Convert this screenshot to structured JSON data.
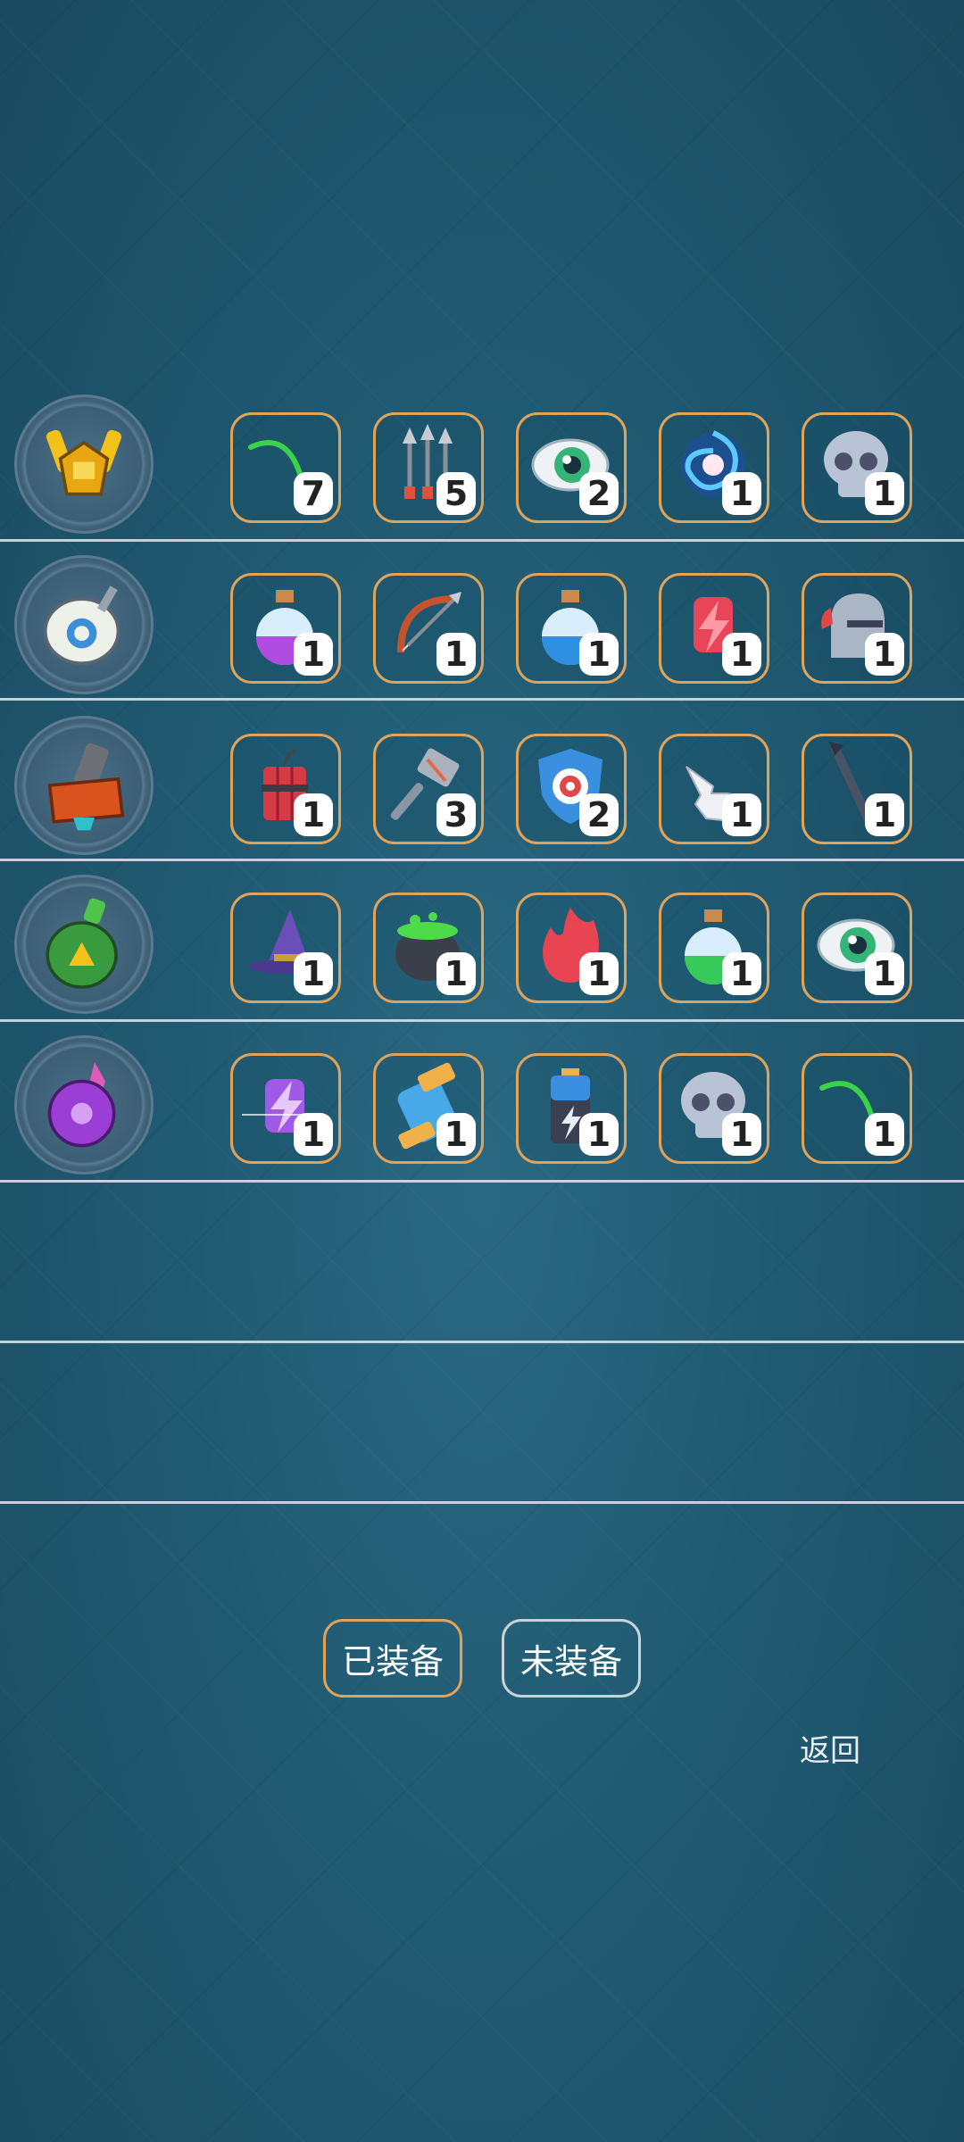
{
  "rows": [
    {
      "hero": "yellow-twin-cannon-icon",
      "items": [
        {
          "icon": "green-twig-icon",
          "count": "7"
        },
        {
          "icon": "arrows-icon",
          "count": "5"
        },
        {
          "icon": "eye-icon",
          "count": "2"
        },
        {
          "icon": "blue-vortex-icon",
          "count": "1"
        },
        {
          "icon": "skull-icon",
          "count": "1"
        }
      ]
    },
    {
      "hero": "white-orb-turret-icon",
      "items": [
        {
          "icon": "purple-potion-icon",
          "count": "1"
        },
        {
          "icon": "bow-icon",
          "count": "1"
        },
        {
          "icon": "blue-potion-icon",
          "count": "1"
        },
        {
          "icon": "red-lightning-icon",
          "count": "1"
        },
        {
          "icon": "helmet-icon",
          "count": "1"
        }
      ]
    },
    {
      "hero": "orange-mortar-icon",
      "items": [
        {
          "icon": "dynamite-icon",
          "count": "1"
        },
        {
          "icon": "hammer-icon",
          "count": "3"
        },
        {
          "icon": "target-shield-icon",
          "count": "2"
        },
        {
          "icon": "pointing-glove-icon",
          "count": "1"
        },
        {
          "icon": "dart-icon",
          "count": "1"
        }
      ]
    },
    {
      "hero": "green-flask-turret-icon",
      "items": [
        {
          "icon": "witch-hat-icon",
          "count": "1"
        },
        {
          "icon": "cauldron-icon",
          "count": "1"
        },
        {
          "icon": "flame-icon",
          "count": "1"
        },
        {
          "icon": "green-potion-icon",
          "count": "1"
        },
        {
          "icon": "eye-icon",
          "count": "1"
        }
      ]
    },
    {
      "hero": "purple-crystal-turret-icon",
      "items": [
        {
          "icon": "purple-lightning-icon",
          "count": "1"
        },
        {
          "icon": "battery-jar-icon",
          "count": "1"
        },
        {
          "icon": "battery-icon",
          "count": "1"
        },
        {
          "icon": "skull-icon",
          "count": "1"
        },
        {
          "icon": "green-twig-icon",
          "count": "1"
        }
      ]
    }
  ],
  "buttons": {
    "equipped": "已装备",
    "unequipped": "未装备"
  },
  "back_label": "返回"
}
